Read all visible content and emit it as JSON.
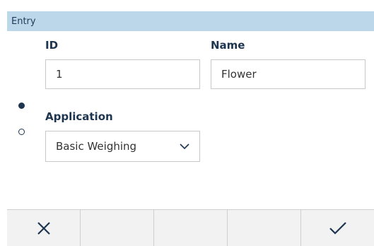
{
  "window": {
    "title": "Entry"
  },
  "fields": {
    "id": {
      "label": "ID",
      "value": "1"
    },
    "name": {
      "label": "Name",
      "value": "Flower"
    },
    "application": {
      "label": "Application",
      "value": "Basic Weighing"
    }
  },
  "pager": {
    "pages": 2,
    "current": 1
  },
  "toolbar": {
    "buttons": [
      {
        "icon": "close-icon"
      },
      {
        "icon": ""
      },
      {
        "icon": ""
      },
      {
        "icon": ""
      },
      {
        "icon": "checkmark-icon"
      }
    ]
  },
  "colors": {
    "title_bar": "#bdd7ea",
    "label_text": "#1e3550",
    "icon": "#1e3550",
    "toolbar_bg": "#f2f2f2"
  }
}
